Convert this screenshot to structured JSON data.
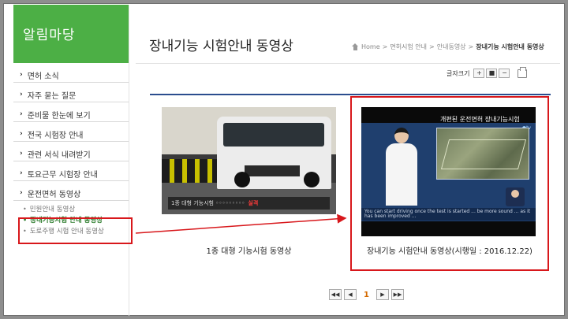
{
  "sidebar": {
    "title": "알림마당",
    "items": [
      {
        "label": "면허 소식"
      },
      {
        "label": "자주 묻는 질문"
      },
      {
        "label": "준비물 한눈에 보기"
      },
      {
        "label": "전국 시험장 안내"
      },
      {
        "label": "관련 서식 내려받기"
      },
      {
        "label": "토요근무 시험장 안내"
      },
      {
        "label": "운전면허 동영상"
      }
    ],
    "subitems": [
      {
        "label": "민원안내 동영상",
        "active": false
      },
      {
        "label": "장내기능시험 안내 동영상",
        "active": true
      },
      {
        "label": "도로주행 시험 안내 동영상",
        "active": false
      }
    ]
  },
  "header": {
    "title": "장내기능 시험안내 동영상",
    "breadcrumb": [
      "Home",
      "면허시험 안내",
      "안내동영상"
    ],
    "breadcrumb_current": "장내기능 시험안내 동영상",
    "breadcrumb_sep": ">"
  },
  "fontsize": {
    "label": "글자크기",
    "plus": "+",
    "reset": "■",
    "minus": "−"
  },
  "videos": [
    {
      "label": "1종 대형 기능시험 동영상",
      "caption": "1종 대형 기능시험 ◦◦◦◦◦◦◦◦◦",
      "caption_mark": "실격"
    },
    {
      "label": "장내기능 시험안내 동영상(시행일 : 2016.12.22)",
      "tv_title": "개편된 운전면허 장내기능시험",
      "ticker": "You can start driving once the test is started ... be more sound ... as it has been improved ..."
    }
  ],
  "pagination": {
    "first": "◀◀",
    "prev": "◀",
    "current": "1",
    "next": "▶",
    "last": "▶▶"
  },
  "colors": {
    "sidebar_green": "#4caf45",
    "highlight_red": "#d8171b",
    "rule_blue": "#2b4d8e"
  }
}
